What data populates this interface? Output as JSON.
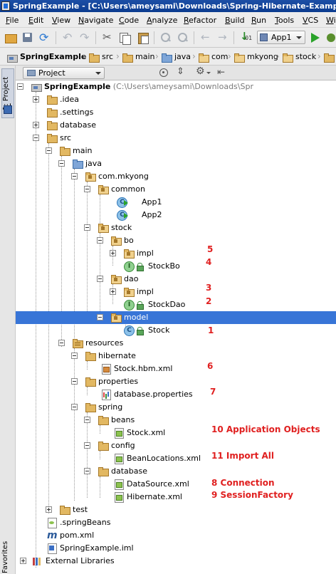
{
  "window": {
    "title": "SpringExample - [C:\\Users\\ameysami\\Downloads\\Spring-Hibernate-Example\\Sp"
  },
  "menu": [
    "File",
    "Edit",
    "View",
    "Navigate",
    "Code",
    "Analyze",
    "Refactor",
    "Build",
    "Run",
    "Tools",
    "VCS",
    "Wi"
  ],
  "toolbar": {
    "run_config": "App1"
  },
  "breadcrumbs": [
    "SpringExample",
    "src",
    "main",
    "java",
    "com",
    "mkyong",
    "stock"
  ],
  "side": {
    "project_tab": "1: Project",
    "favorites_tab": "Favorites"
  },
  "panel": {
    "view": "Project"
  },
  "tree": {
    "root": "SpringExample",
    "root_path": "(C:\\Users\\ameysami\\Downloads\\Spr",
    "idea": ".idea",
    "settings": ".settings",
    "database": "database",
    "src": "src",
    "main": "main",
    "java": "java",
    "com_mkyong": "com.mkyong",
    "common": "common",
    "app1": "App1",
    "app2": "App2",
    "stock": "stock",
    "bo": "bo",
    "bo_impl": "impl",
    "stockbo": "StockBo",
    "dao": "dao",
    "dao_impl": "impl",
    "stockdao": "StockDao",
    "model": "model",
    "stock_class": "Stock",
    "resources": "resources",
    "hibernate": "hibernate",
    "stock_hbm": "Stock.hbm.xml",
    "properties": "properties",
    "db_props": "database.properties",
    "spring": "spring",
    "beans": "beans",
    "stock_xml": "Stock.xml",
    "config": "config",
    "beanlocations": "BeanLocations.xml",
    "database_dir": "database",
    "datasource": "DataSource.xml",
    "hibernate_xml": "Hibernate.xml",
    "test": "test",
    "springbeans": ".springBeans",
    "pom": "pom.xml",
    "iml": "SpringExample.iml",
    "ext_libs": "External Libraries"
  },
  "annotations": {
    "n1": "1",
    "n2": "2",
    "n3": "3",
    "n4": "4",
    "n5": "5",
    "n6": "6",
    "n7": "7",
    "n10": "10 Application Objects",
    "n11": "11 Import All",
    "n8": "8 Connection",
    "n9": "9 SessionFactory",
    "color": "#e02020"
  },
  "colors": {
    "selection": "#3875d7",
    "titlebar": "#0b3b8f"
  }
}
